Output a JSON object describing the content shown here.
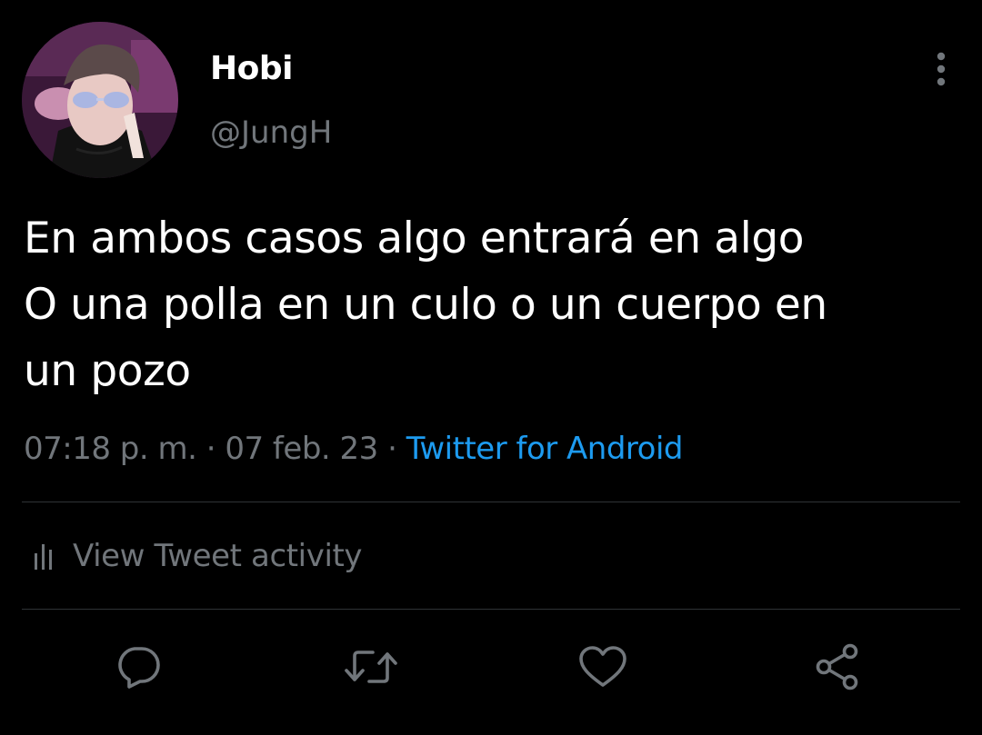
{
  "author": {
    "display_name": "Hobi",
    "handle": "@JungH"
  },
  "tweet": {
    "lines": [
      "En ambos casos algo entrará en algo",
      "O una polla en un culo o un cuerpo en",
      "un pozo"
    ],
    "time": "07:18 p. m.",
    "separator": "·",
    "date": "07 feb. 23",
    "source": "Twitter for Android"
  },
  "activity": {
    "label": "View Tweet activity",
    "icon": "bar-chart-icon"
  },
  "actions": [
    {
      "name": "reply",
      "icon": "reply-icon"
    },
    {
      "name": "retweet",
      "icon": "retweet-icon"
    },
    {
      "name": "like",
      "icon": "heart-icon"
    },
    {
      "name": "share",
      "icon": "share-icon"
    }
  ],
  "colors": {
    "background": "#000000",
    "text_primary": "#ffffff",
    "text_secondary": "#71767b",
    "link": "#1d9bf0",
    "divider": "#2f3336"
  }
}
